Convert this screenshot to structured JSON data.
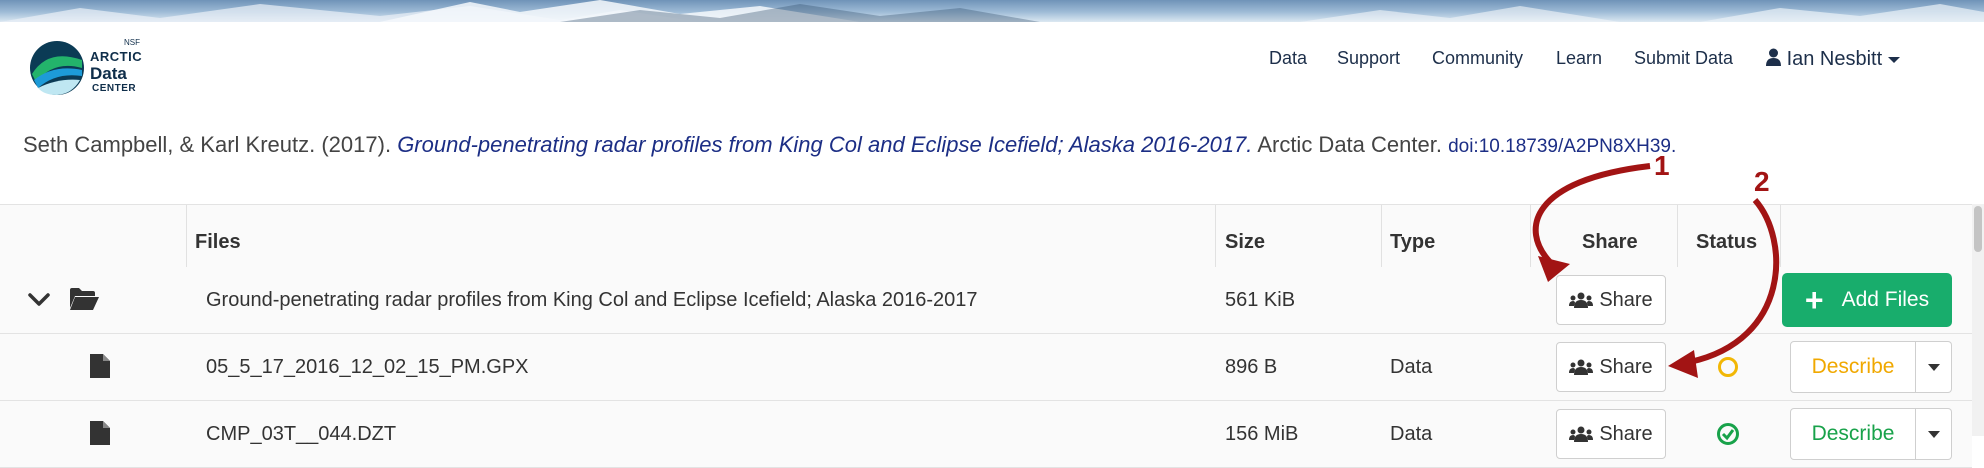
{
  "colors": {
    "accent_green": "#18ad6c",
    "link_blue": "#1c2e85",
    "annotation_red": "#a21414",
    "status_pending": "#f2b705",
    "status_ok": "#18a24a"
  },
  "logo": {
    "nsf": "NSF",
    "line1": "ARCTIC",
    "line2": "Data",
    "line3": "CENTER"
  },
  "nav": {
    "items": [
      "Data",
      "Support",
      "Community",
      "Learn",
      "Submit Data"
    ],
    "user": "Ian Nesbitt",
    "user_icon": "user-icon"
  },
  "citation": {
    "authors": "Seth Campbell, & Karl Kreutz. (2017).",
    "title": "Ground-penetrating radar profiles from King Col and Eclipse Icefield; Alaska 2016-2017.",
    "publisher": "Arctic Data Center.",
    "doi": "doi:10.18739/A2PN8XH39."
  },
  "table": {
    "headers": {
      "files": "Files",
      "size": "Size",
      "type": "Type",
      "share": "Share",
      "status": "Status"
    },
    "folder": {
      "name": "Ground-penetrating radar profiles from King Col and Eclipse Icefield; Alaska 2016-2017",
      "size": "561 KiB",
      "share_label": "Share",
      "add_label": "Add Files"
    },
    "rows": [
      {
        "name": "05_5_17_2016_12_02_15_PM.GPX",
        "size": "896 B",
        "type": "Data",
        "share_label": "Share",
        "status": "pending",
        "describe_label": "Describe"
      },
      {
        "name": "CMP_03T__044.DZT",
        "size": "156 MiB",
        "type": "Data",
        "share_label": "Share",
        "status": "complete",
        "describe_label": "Describe"
      }
    ]
  },
  "annotations": {
    "one": "1",
    "two": "2"
  }
}
